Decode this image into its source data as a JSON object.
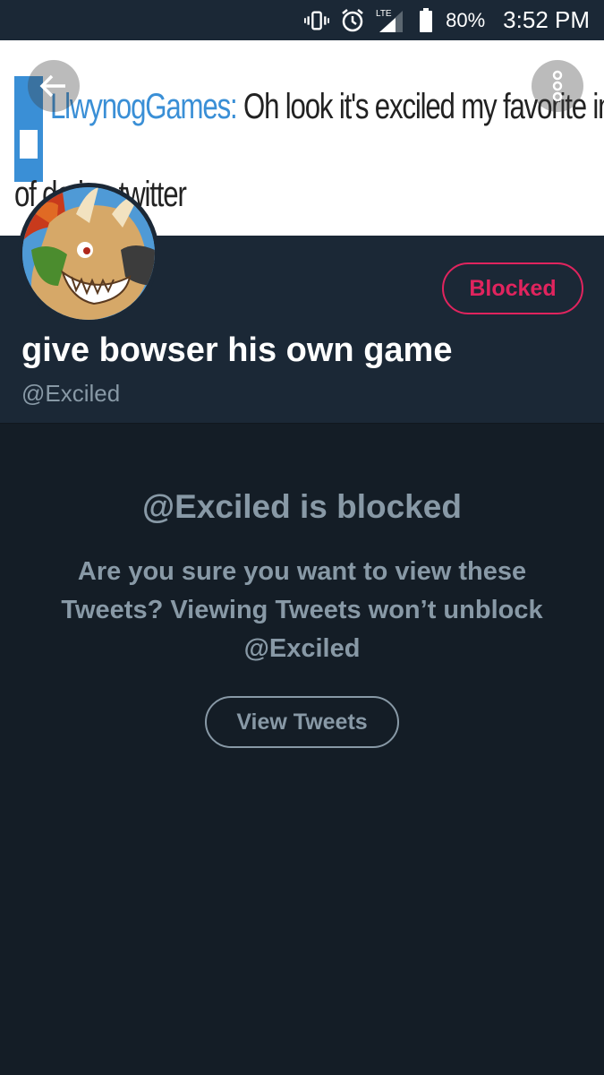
{
  "status_bar": {
    "icons": [
      "vibrate-icon",
      "alarm-icon",
      "lte-signal-icon",
      "battery-icon"
    ],
    "lte_label": "LTE",
    "battery": "80%",
    "time": "3:52 PM"
  },
  "banner": {
    "username": "LlwynogGames:",
    "line1_text": " Oh look it's exciled my favorite inhabitant",
    "line2_text": "of de        ion twitter"
  },
  "header_buttons": {
    "back_icon": "arrow-left-icon",
    "more_icon": "more-vertical-icon"
  },
  "profile": {
    "display_name": "give bowser his own game",
    "handle": "@Exciled",
    "blocked_label": "Blocked"
  },
  "notice": {
    "title": "@Exciled is blocked",
    "body": "Are you sure you want to view these Tweets? Viewing Tweets won’t unblock @Exciled",
    "view_label": "View Tweets"
  },
  "colors": {
    "background": "#141d26",
    "panel": "#1b2836",
    "blocked_red": "#e0245e",
    "muted_text": "#8899a6",
    "link_blue": "#3a8fd6"
  }
}
